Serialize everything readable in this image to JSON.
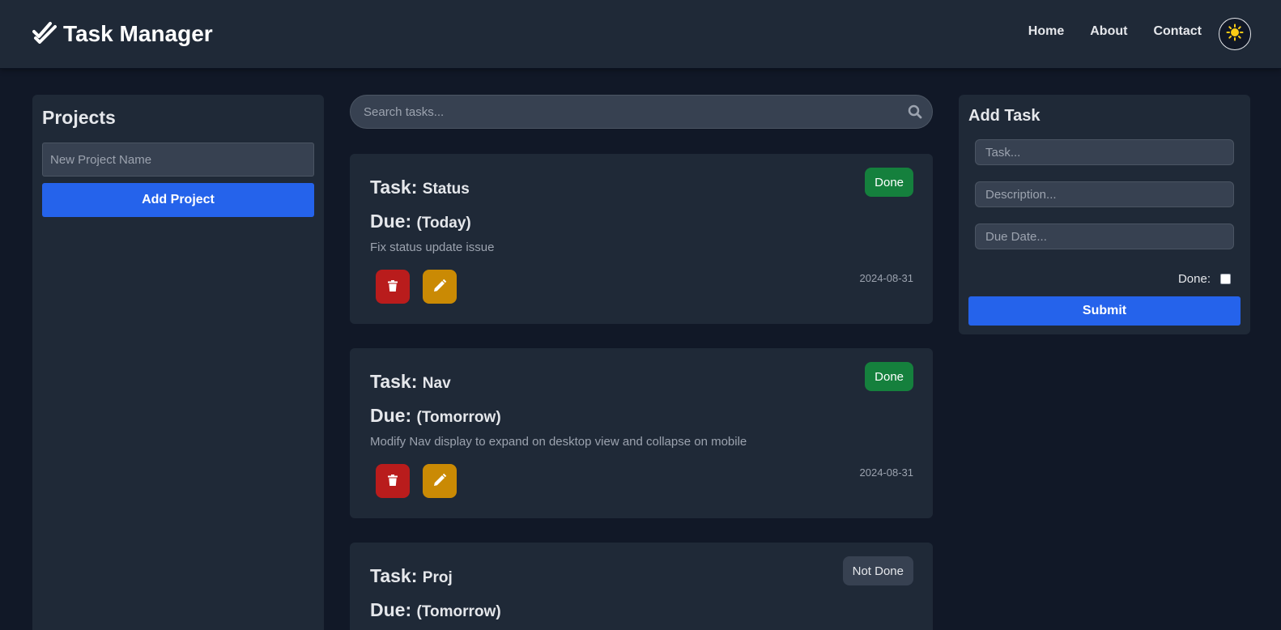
{
  "header": {
    "brand": "Task Manager",
    "nav": [
      "Home",
      "About",
      "Contact"
    ]
  },
  "projects": {
    "title": "Projects",
    "input_placeholder": "New Project Name",
    "add_button": "Add Project"
  },
  "search": {
    "placeholder": "Search tasks..."
  },
  "tasks": [
    {
      "task_label": "Task:",
      "name": "Status",
      "due_label": "Due:",
      "due": "(Today)",
      "description": "Fix status update issue",
      "status": "Done",
      "date": "2024-08-31"
    },
    {
      "task_label": "Task:",
      "name": "Nav",
      "due_label": "Due:",
      "due": "(Tomorrow)",
      "description": "Modify Nav display to expand on desktop view and collapse on mobile",
      "status": "Done",
      "date": "2024-08-31"
    },
    {
      "task_label": "Task:",
      "name": "Proj",
      "due_label": "Due:",
      "due": "(Tomorrow)",
      "description": "",
      "status": "Not Done",
      "date": ""
    }
  ],
  "add_task": {
    "title": "Add Task",
    "task_placeholder": "Task...",
    "description_placeholder": "Description...",
    "due_placeholder": "Due Date...",
    "done_label": "Done:",
    "submit": "Submit"
  },
  "colors": {
    "background": "#111827",
    "panel": "#1f2937",
    "primary": "#2563eb",
    "done": "#15803d",
    "not_done": "#374151",
    "delete": "#b91c1c",
    "edit": "#ca8a04"
  }
}
